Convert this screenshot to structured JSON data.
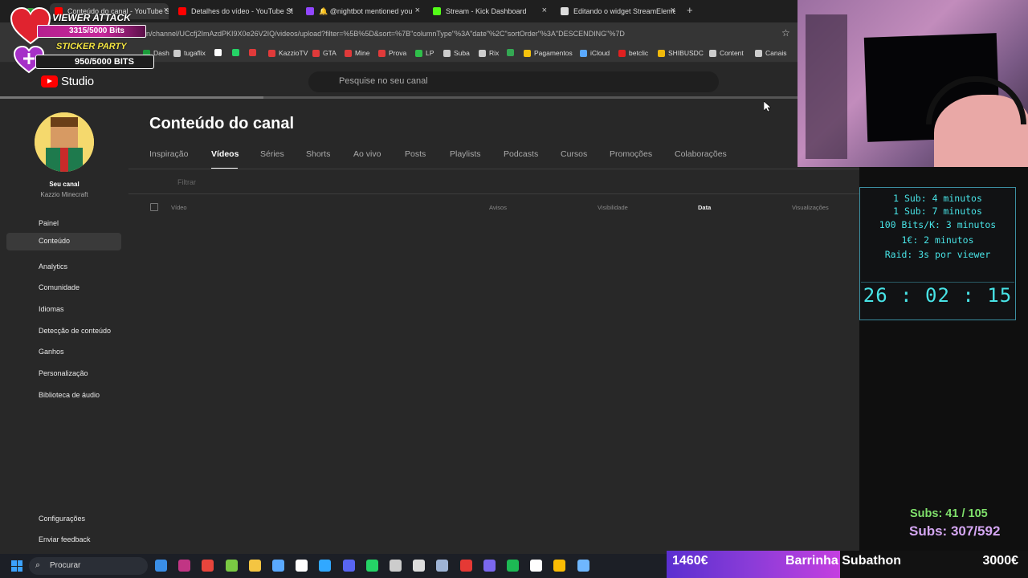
{
  "browser": {
    "tabs": [
      {
        "label": "Conteúdo do canal - YouTube Studio",
        "color": "#ff0000"
      },
      {
        "label": "Detalhes do vídeo - YouTube Studio",
        "color": "#ff0000"
      },
      {
        "label": "🔔 @nightbot mentioned you",
        "color": "#9146ff"
      },
      {
        "label": "Stream - Kick Dashboard",
        "color": "#53fc18"
      },
      {
        "label": "Editando o widget StreamElements",
        "color": "#ffffff"
      }
    ],
    "new_tab": "+",
    "close": "×",
    "url": "n/channel/UCcfj2ImAzdPKI9X0e26V2IQ/videos/upload?filter=%5B%5D&sort=%7B\"columnType\"%3A\"date\"%2C\"sortOrder\"%3A\"DESCENDING\"%7D",
    "star": "☆",
    "bookmarks": [
      {
        "label": "Dash",
        "color": "#1b9c3a"
      },
      {
        "label": "tugaflix",
        "color": "#cccccc"
      },
      {
        "label": "",
        "color": "#ffffff"
      },
      {
        "label": "",
        "color": "#25d366"
      },
      {
        "label": "",
        "color": "#e03a3a"
      },
      {
        "label": "KazzioTV",
        "color": "#e03a3a"
      },
      {
        "label": "GTA",
        "color": "#e03a3a"
      },
      {
        "label": "Mine",
        "color": "#e03a3a"
      },
      {
        "label": "Prova",
        "color": "#e03a3a"
      },
      {
        "label": "LP",
        "color": "#2fbf4a"
      },
      {
        "label": "Suba",
        "color": "#cccccc"
      },
      {
        "label": "Rix",
        "color": "#cccccc"
      },
      {
        "label": "",
        "color": "#34a853"
      },
      {
        "label": "Pagamentos",
        "color": "#f4c20d"
      },
      {
        "label": "iCloud",
        "color": "#5aa9ff"
      },
      {
        "label": "betclic",
        "color": "#e02020"
      },
      {
        "label": "SHIBUSDC",
        "color": "#f0b90b"
      },
      {
        "label": "Content",
        "color": "#cccccc"
      },
      {
        "label": "Canais",
        "color": "#cccccc"
      }
    ]
  },
  "studio": {
    "logo_text": "Studio",
    "search_placeholder": "Pesquise no seu canal",
    "channel_label": "Seu canal",
    "channel_name": "Kazzio Minecraft",
    "nav": [
      "Painel",
      "Conteúdo",
      "Analytics",
      "Comunidade",
      "Idiomas",
      "Detecção de conteúdo",
      "Ganhos",
      "Personalização",
      "Biblioteca de áudio"
    ],
    "nav_bottom": [
      "Configurações",
      "Enviar feedback"
    ],
    "page_title": "Conteúdo do canal",
    "tabs": [
      "Inspiração",
      "Vídeos",
      "Séries",
      "Shorts",
      "Ao vivo",
      "Posts",
      "Playlists",
      "Podcasts",
      "Cursos",
      "Promoções",
      "Colaborações"
    ],
    "filter_placeholder": "Filtrar",
    "columns": [
      "Vídeo",
      "Avisos",
      "Visibilidade",
      "Data",
      "Visualizações"
    ]
  },
  "alerts": {
    "title1": "VIEWER ATTACK",
    "bar1": "3315/5000 Bits",
    "bar1_progress": 0.663,
    "title2": "STICKER PARTY",
    "bar2": "950/5000 BITS"
  },
  "timer": {
    "lines": [
      "1 Sub: 4 minutos",
      "1 Sub: 7 minutos",
      "100 Bits/K: 3 minutos",
      "1€: 2 minutos",
      "Raid: 3s por viewer"
    ],
    "clock": "26 : 02 : 15"
  },
  "subs": {
    "line1": "Subs: 41 / 105",
    "line2": "Subs: 307/592"
  },
  "taskbar": {
    "search_label": "Procurar",
    "icons": [
      {
        "name": "photos-icon",
        "color": "#3a8ee6"
      },
      {
        "name": "instagram-icon",
        "color": "#c13584"
      },
      {
        "name": "chrome-icon",
        "color": "#e8453c"
      },
      {
        "name": "app-icon",
        "color": "#7ac943"
      },
      {
        "name": "folder-icon",
        "color": "#f4c542"
      },
      {
        "name": "calculator-icon",
        "color": "#5aa9ff"
      },
      {
        "name": "capcut-icon",
        "color": "#ffffff"
      },
      {
        "name": "photoshop-icon",
        "color": "#31a8ff"
      },
      {
        "name": "discord-icon",
        "color": "#5865f2"
      },
      {
        "name": "whatsapp-icon",
        "color": "#25d366"
      },
      {
        "name": "epic-icon",
        "color": "#cccccc"
      },
      {
        "name": "obs-icon",
        "color": "#dddddd"
      },
      {
        "name": "steam-icon",
        "color": "#9fb4d6"
      },
      {
        "name": "power-icon",
        "color": "#e53935"
      },
      {
        "name": "grid-app-icon",
        "color": "#7b68ee"
      },
      {
        "name": "spotify-icon",
        "color": "#1db954"
      },
      {
        "name": "capcut2-icon",
        "color": "#ffffff"
      },
      {
        "name": "drive-icon",
        "color": "#fbbc04"
      },
      {
        "name": "notepad-icon",
        "color": "#6fb7ff"
      }
    ]
  },
  "subathon": {
    "left_value": "1460€",
    "label": "Barrinha Subathon",
    "right_value": "3000€"
  }
}
